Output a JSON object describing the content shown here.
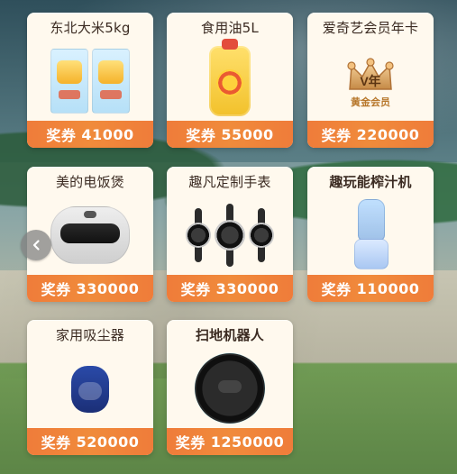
{
  "items": [
    {
      "title": "东北大米5kg",
      "price_label": "奖券",
      "price_value": "41000",
      "icon": "rice-bags-icon"
    },
    {
      "title": "食用油5L",
      "price_label": "奖券",
      "price_value": "55000",
      "icon": "cooking-oil-icon"
    },
    {
      "title": "爱奇艺会员年卡",
      "price_label": "奖券",
      "price_value": "220000",
      "icon": "vip-crown-icon",
      "badge_text": "V年",
      "badge_subtext": "黄金会员"
    },
    {
      "title": "美的电饭煲",
      "price_label": "奖券",
      "price_value": "330000",
      "icon": "rice-cooker-icon"
    },
    {
      "title": "趣凡定制手表",
      "price_label": "奖券",
      "price_value": "330000",
      "icon": "watches-icon"
    },
    {
      "title": "趣玩能榨汁机",
      "price_label": "奖券",
      "price_value": "110000",
      "icon": "blender-icon"
    },
    {
      "title": "家用吸尘器",
      "price_label": "奖券",
      "price_value": "520000",
      "icon": "vacuum-icon"
    },
    {
      "title": "扫地机器人",
      "price_label": "奖券",
      "price_value": "1250000",
      "icon": "robot-vacuum-icon"
    }
  ],
  "nav": {
    "prev_icon": "chevron-left-icon"
  },
  "colors": {
    "card_bg": "#fff9ee",
    "price_bar": "#ef7c3a",
    "title_text": "#3b2b22"
  }
}
